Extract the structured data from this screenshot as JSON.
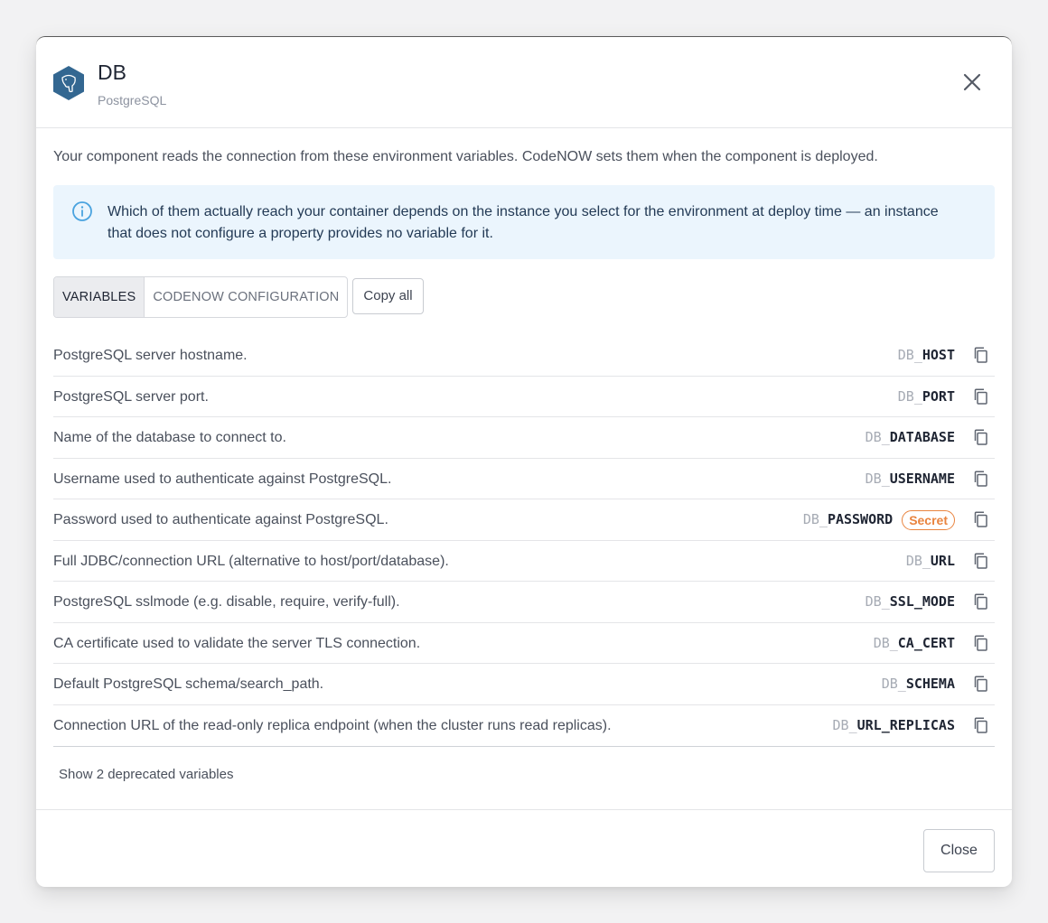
{
  "header": {
    "title": "DB",
    "subtitle": "PostgreSQL",
    "logo_icon": "postgresql-elephant-icon",
    "close_icon": "close-icon"
  },
  "intro": "Your component reads the connection from these environment variables. CodeNOW sets them when the component is deployed.",
  "info": {
    "icon": "info-icon",
    "text": "Which of them actually reach your container depends on the instance you select for the environment at deploy time — an instance that does not configure a property provides no variable for it."
  },
  "tabs": [
    {
      "label": "VARIABLES",
      "active": true
    },
    {
      "label": "CODENOW CONFIGURATION",
      "active": false
    }
  ],
  "copy_all_label": "Copy all",
  "variables": [
    {
      "description": "PostgreSQL server hostname.",
      "prefix": "DB_",
      "name": "HOST"
    },
    {
      "description": "PostgreSQL server port.",
      "prefix": "DB_",
      "name": "PORT"
    },
    {
      "description": "Name of the database to connect to.",
      "prefix": "DB_",
      "name": "DATABASE"
    },
    {
      "description": "Username used to authenticate against PostgreSQL.",
      "prefix": "DB_",
      "name": "USERNAME"
    },
    {
      "description": "Password used to authenticate against PostgreSQL.",
      "prefix": "DB_",
      "name": "PASSWORD",
      "badge": "Secret"
    },
    {
      "description": "Full JDBC/connection URL (alternative to host/port/database).",
      "prefix": "DB_",
      "name": "URL"
    },
    {
      "description": "PostgreSQL sslmode (e.g. disable, require, verify-full).",
      "prefix": "DB_",
      "name": "SSL_MODE"
    },
    {
      "description": "CA certificate used to validate the server TLS connection.",
      "prefix": "DB_",
      "name": "CA_CERT"
    },
    {
      "description": "Default PostgreSQL schema/search_path.",
      "prefix": "DB_",
      "name": "SCHEMA"
    },
    {
      "description": "Connection URL of the read-only replica endpoint (when the cluster runs read replicas).",
      "prefix": "DB_",
      "name": "URL_REPLICAS"
    }
  ],
  "deprecated_toggle": "Show 2 deprecated variables",
  "footer": {
    "close_label": "Close"
  },
  "colors": {
    "accent_info_bg": "#ebf5fd",
    "info_icon": "#4aa3df",
    "secret_badge": "#e9843f",
    "logo": "#336791"
  }
}
